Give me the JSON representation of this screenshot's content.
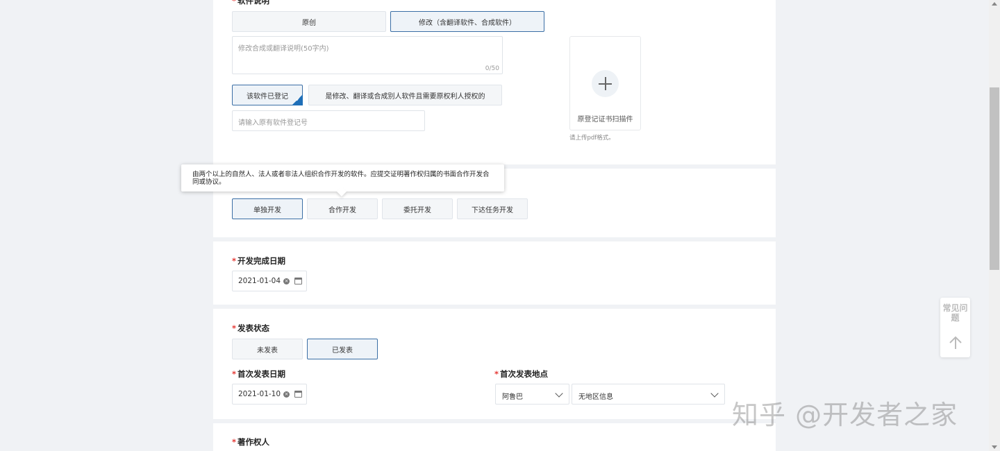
{
  "software_desc": {
    "label": "软件说明",
    "options": [
      "原创",
      "修改（含翻译软件、合成软件）"
    ],
    "textarea_placeholder": "修改合成或翻译说明(50字内)",
    "char_count": "0/50",
    "registered_option": "该软件已登记",
    "authorized_option": "是修改、翻译或合成别人软件且需要原权利人授权的",
    "reg_number_placeholder": "请输入原有软件登记号",
    "upload_label": "原登记证书扫描件",
    "upload_hint": "请上传pdf格式。"
  },
  "tooltip": "由两个以上的自然人、法人或者非法人组织合作开发的软件。应提交证明著作权归属的书面合作开发合同或协议。",
  "dev_mode": {
    "options": [
      "单独开发",
      "合作开发",
      "委托开发",
      "下达任务开发"
    ]
  },
  "completion": {
    "label": "开发完成日期",
    "date": "2021-01-04"
  },
  "publish": {
    "label": "发表状态",
    "options": [
      "未发表",
      "已发表"
    ],
    "first_date_label": "首次发表日期",
    "first_date": "2021-01-10",
    "first_place_label": "首次发表地点",
    "country": "阿鲁巴",
    "region": "无地区信息"
  },
  "copyright": {
    "label": "著作权人"
  },
  "float_panel": {
    "faq": "常见问题"
  },
  "watermark": "知乎 @开发者之家",
  "colors": {
    "accent": "#1f6fb8",
    "required": "#e53935",
    "selected_border": "#3a6ea5"
  }
}
